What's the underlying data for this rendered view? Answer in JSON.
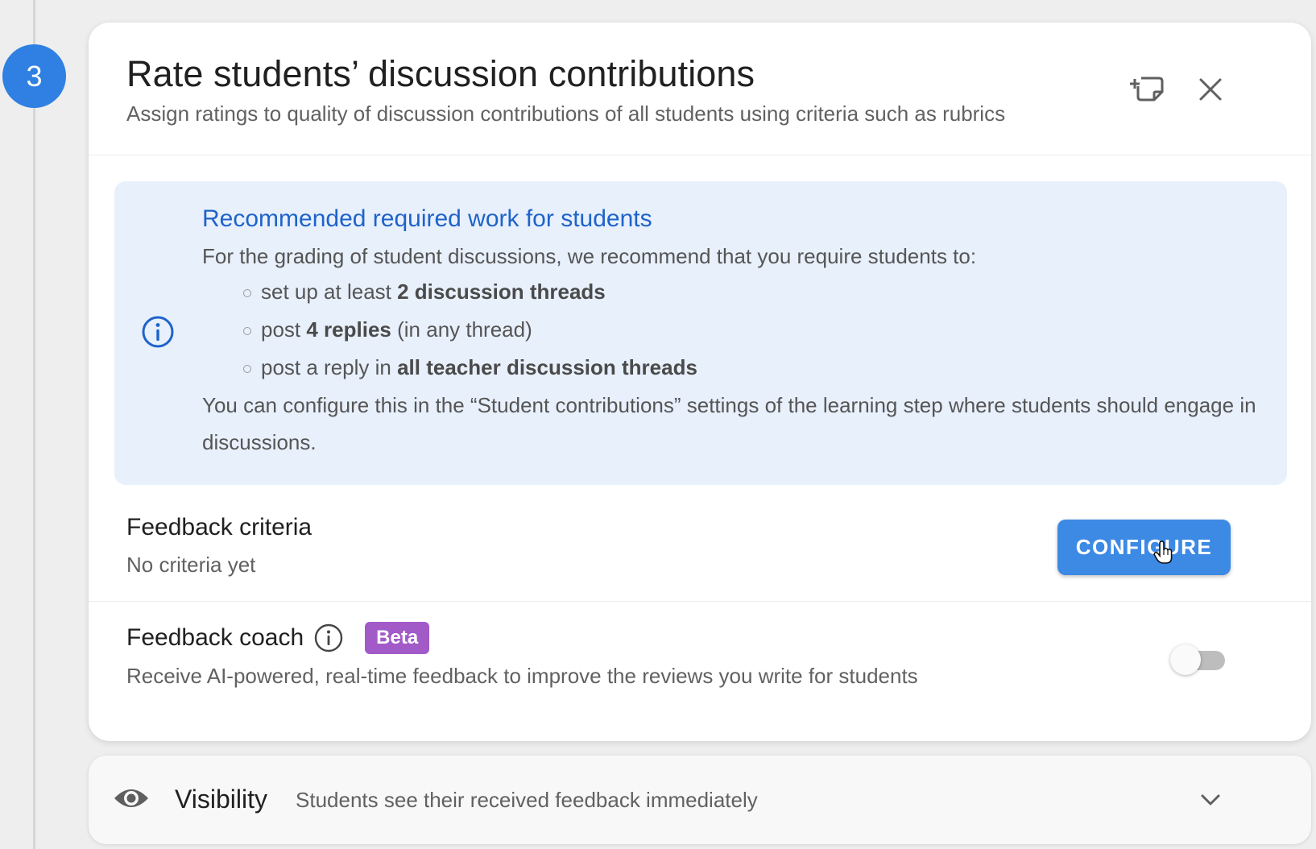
{
  "step": {
    "number": "3"
  },
  "card": {
    "title": "Rate students’ discussion contributions",
    "subtitle": "Assign ratings to quality of discussion contributions of all students using criteria such as rubrics",
    "icons": {
      "add_to_library": "add-to-library-icon",
      "close": "close-icon"
    }
  },
  "recommendation": {
    "icon": "info-icon",
    "title": "Recommended required work for students",
    "intro": "For the grading of student discussions, we recommend that you require students to:",
    "items": [
      {
        "before": "set up at least ",
        "bold": "2 discussion threads",
        "after": ""
      },
      {
        "before": "post ",
        "bold": "4 replies",
        "after": " (in any thread)"
      },
      {
        "before": "post a reply in ",
        "bold": "all teacher discussion threads",
        "after": ""
      }
    ],
    "outro": "You can configure this in the “Student contributions” settings of the learning step where students should engage in discussions."
  },
  "feedback_criteria": {
    "title": "Feedback criteria",
    "status": "No criteria yet",
    "button_label": "CONFIGURE"
  },
  "feedback_coach": {
    "title": "Feedback coach",
    "badge": "Beta",
    "description": "Receive AI-powered, real-time feedback to improve the reviews you write for students",
    "enabled": false
  },
  "visibility": {
    "icon": "eye-icon",
    "label": "Visibility",
    "value": "Students see their received feedback immediately"
  },
  "colors": {
    "accent": "#2f80e2",
    "button": "#3d8ae5",
    "info_bg": "#e8f0fc",
    "info_title": "#1e63c9",
    "beta": "#a25ac9"
  }
}
